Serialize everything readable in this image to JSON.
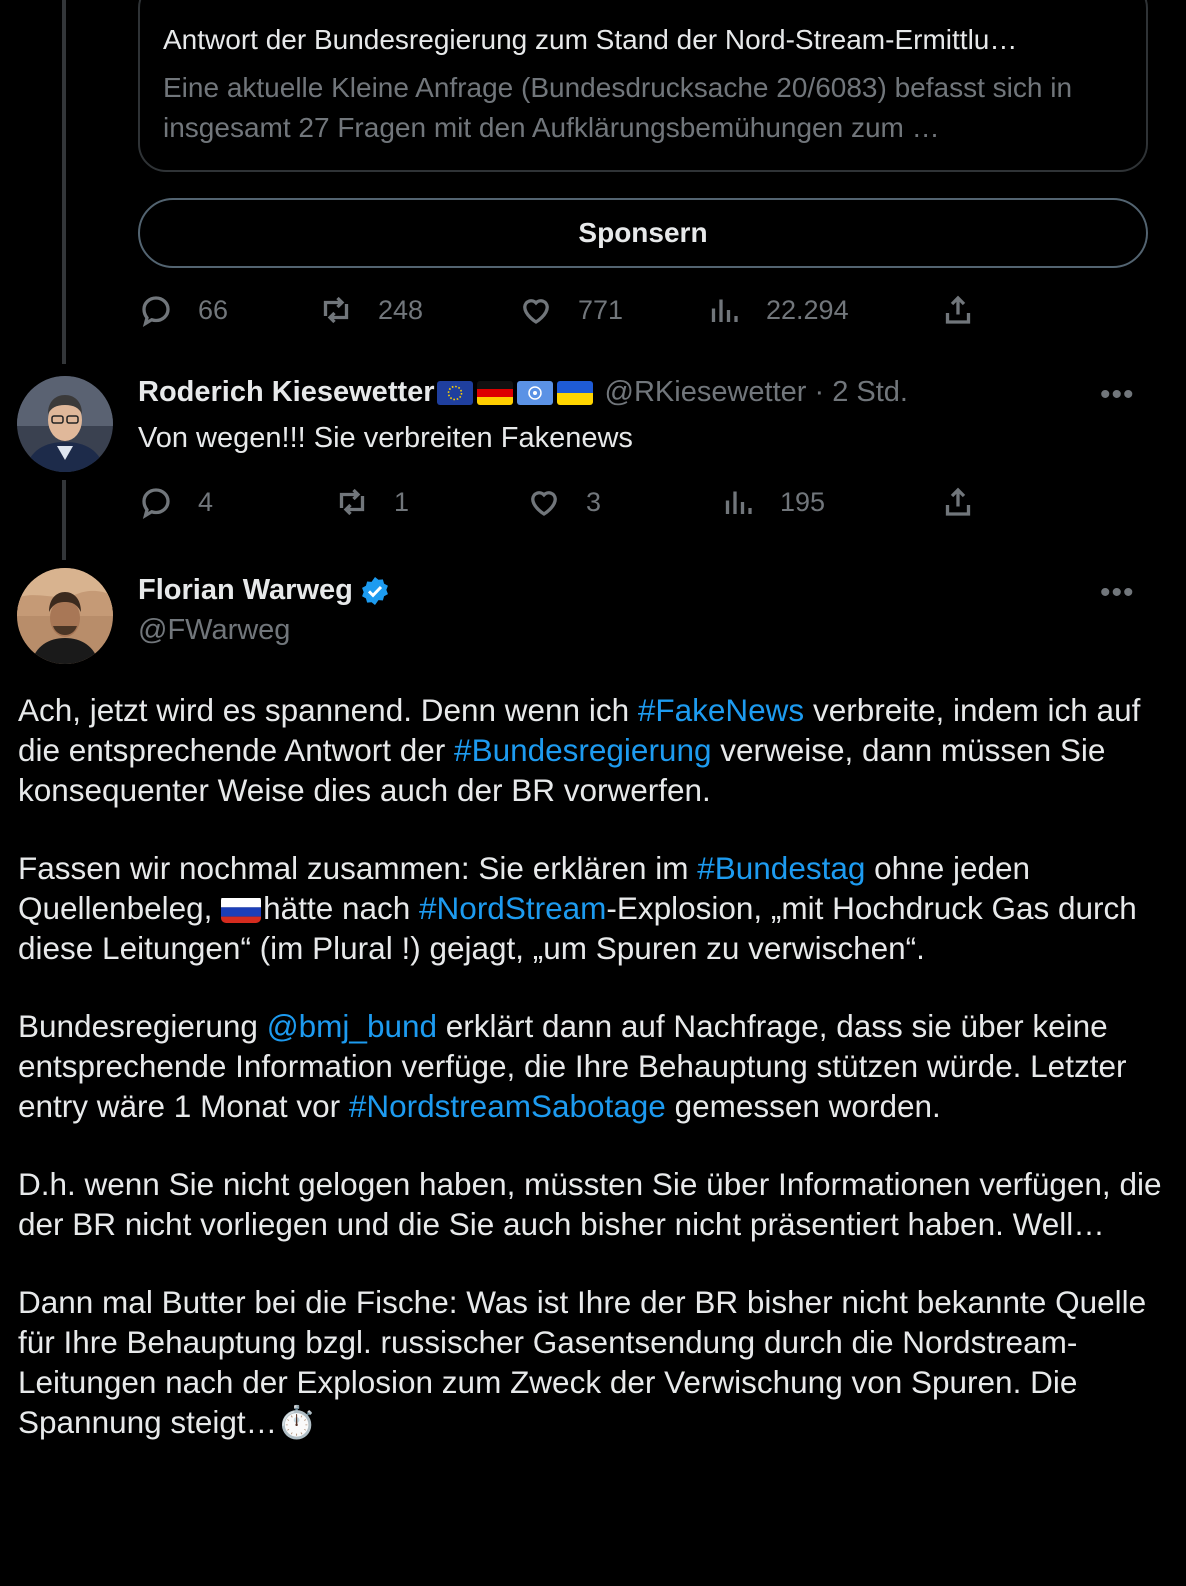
{
  "link_card": {
    "title": "Antwort der Bundesregierung zum Stand der Nord-Stream-Ermittlu…",
    "description": "Eine aktuelle Kleine Anfrage (Bundesdrucksache 20/6083) befasst sich in insgesamt 27 Fragen mit den Aufklärungsbemühungen zum …"
  },
  "sponsor_button": {
    "label": "Sponsern"
  },
  "tweet1_actions": {
    "replies": "66",
    "retweets": "248",
    "likes": "771",
    "views": "22.294"
  },
  "reply": {
    "name": "Roderich Kiesewetter",
    "flags": [
      "eu-flag",
      "germany-flag",
      "un-flag",
      "ukraine-flag"
    ],
    "handle": "@RKiesewetter · 2 Std.",
    "text": "Von wegen!!! Sie verbreiten Fakenews",
    "actions": {
      "replies": "4",
      "retweets": "1",
      "likes": "3",
      "views": "195"
    }
  },
  "main_tweet": {
    "name": "Florian Warweg",
    "handle": "@FWarweg",
    "verified": true,
    "p1": {
      "a": "Ach, jetzt wird es spannend. Denn wenn ich ",
      "tag1": "#FakeNews",
      "b": " verbreite, indem ich auf die entsprechende Antwort der ",
      "tag2": "#Bundesregierung",
      "c": " verweise, dann müssen Sie konsequenter Weise dies  auch der BR vorwerfen."
    },
    "p2": {
      "a": "Fassen wir nochmal zusammen: Sie erklären im ",
      "tag1": "#Bundestag",
      "b": " ohne jeden Quellenbeleg, ",
      "flag": "russia-flag",
      "c": "hätte nach ",
      "tag2": "#NordStream",
      "d": "-Explosion, „mit Hochdruck Gas durch diese Leitungen“ (im Plural !) gejagt, „um Spuren zu verwischen“."
    },
    "p3": {
      "a": "Bundesregierung ",
      "mention": "@bmj_bund",
      "b": " erklärt dann auf Nachfrage, dass sie über keine entsprechende Information verfüge, die Ihre Behauptung stützen würde. Letzter entry wäre 1 Monat vor ",
      "tag": "#NordstreamSabotage",
      "c": " gemessen worden."
    },
    "p4": "D.h. wenn Sie nicht gelogen haben, müssten Sie über Informationen verfügen, die der BR nicht vorliegen und die Sie auch bisher nicht präsentiert haben. Well…",
    "p5": "Dann mal Butter bei die Fische: Was ist Ihre der BR bisher nicht bekannte Quelle für Ihre Behauptung bzgl. russischer Gasentsendung durch die Nordstream-Leitungen nach der Explosion zum Zweck der Verwischung von Spuren. Die Spannung steigt…",
    "p5_emoji": "⏱️"
  },
  "colors": {
    "accent": "#1d9bf0",
    "secondary_text": "#71767b",
    "border": "#2f3336"
  }
}
